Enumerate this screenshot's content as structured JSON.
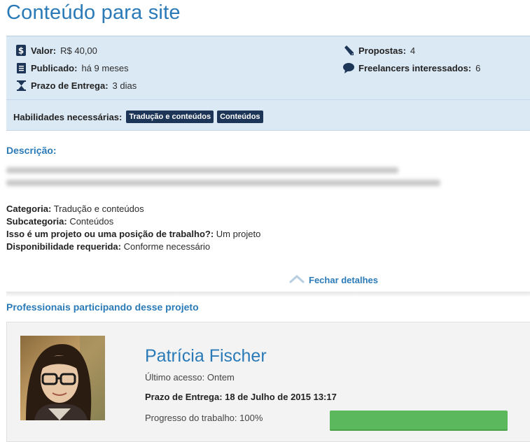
{
  "title": "Conteúdo para site",
  "info": {
    "valor": {
      "label": "Valor:",
      "value": "R$ 40,00",
      "icon": "dollar-icon"
    },
    "publicado": {
      "label": "Publicado:",
      "value": "há 9 meses",
      "icon": "document-icon"
    },
    "prazo": {
      "label": "Prazo de Entrega:",
      "value": "3 dias",
      "icon": "hourglass-icon"
    },
    "propostas": {
      "label": "Propostas:",
      "value": "4",
      "icon": "pencil-icon"
    },
    "freelancers": {
      "label": "Freelancers interessados:",
      "value": "6",
      "icon": "speech-bubble-icon"
    }
  },
  "skills": {
    "label": "Habilidades necessárias:",
    "tags": [
      "Tradução e conteúdos",
      "Conteúdos"
    ]
  },
  "descricao": {
    "heading": "Descrição:"
  },
  "details": [
    {
      "label": "Categoria:",
      "value": "Tradução e conteúdos"
    },
    {
      "label": "Subcategoria:",
      "value": "Conteúdos"
    },
    {
      "label": "Isso é um projeto ou uma posição de trabalho?:",
      "value": "Um projeto"
    },
    {
      "label": "Disponibilidade requerida:",
      "value": "Conforme necessário"
    }
  ],
  "close_details": "Fechar detalhes",
  "professionals": {
    "heading": "Professionais participando desse projeto",
    "items": [
      {
        "name": "Patrícia Fischer",
        "last_access": "Último acesso: Ontem",
        "deadline_label": "Prazo de Entrega:",
        "deadline_value": "18 de Julho de 2015 13:17",
        "progress_label": "Progresso do trabalho: 100%",
        "progress": 1.0
      }
    ]
  },
  "colors": {
    "accent": "#2a7ab8",
    "info_bg": "#dbe9f5",
    "tag_bg": "#1d3557",
    "progress": "#5cb85c"
  }
}
